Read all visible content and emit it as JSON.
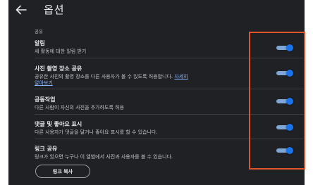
{
  "header": {
    "title": "옵션"
  },
  "section": {
    "label": "공유"
  },
  "settings": [
    {
      "title": "알림",
      "description": "새 활동에 대한 알림 받기",
      "enabled": true
    },
    {
      "title": "사진 촬영 장소 공유",
      "description": "공유한 사진의 촬영 장소를 다른 사용자가 볼 수 있도록 허용합니다.",
      "link_part1": "자세히",
      "link_part2": "알아보기",
      "enabled": true
    },
    {
      "title": "공동작업",
      "description": "다른 사람이 자신의 사진을 추가하도록 허용",
      "enabled": true
    },
    {
      "title": "댓글 및 좋아요 표시",
      "description": "다른 사용자가 댓글을 달거나 좋아요 표시를 할 수 있습니다.",
      "enabled": true
    },
    {
      "title": "링크 공유",
      "description": "링크가 있으면 누구나 이 앨범에서 사진과 사용자를 볼 수 있습니다.",
      "enabled": true
    }
  ],
  "copy_link_button": {
    "label": "링크 복사"
  },
  "colors": {
    "background": "#202124",
    "toggle_on": "#1a73e8",
    "link": "#8ab4f8",
    "annotation_box": "#e2552b"
  },
  "icons": {
    "back": "arrow-left-icon"
  }
}
